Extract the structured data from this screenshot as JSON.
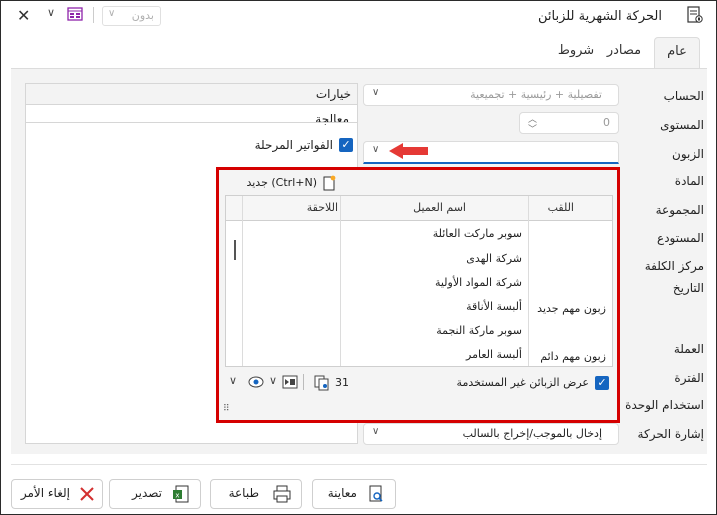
{
  "window": {
    "title": "الحركة الشهرية للزبائن",
    "view_select": "بدون"
  },
  "tabs": [
    {
      "label": "عام"
    },
    {
      "label": "مصادر"
    },
    {
      "label": "شروط"
    }
  ],
  "fields": {
    "account": {
      "label": "الحساب",
      "value": "تفصيلية + رئيسية + تجميعية"
    },
    "level": {
      "label": "المستوى",
      "value": "0"
    },
    "customer": {
      "label": "الزبون"
    },
    "material": {
      "label": "المادة"
    },
    "group": {
      "label": "المجموعة"
    },
    "warehouse": {
      "label": "المستودع"
    },
    "cost_center": {
      "label": "مركز الكلفة"
    },
    "date": {
      "label": "التاريخ"
    },
    "currency": {
      "label": "العملة"
    },
    "period": {
      "label": "الفترة"
    },
    "unit_usage": {
      "label": "استخدام الوحدة"
    },
    "movement_sign": {
      "label": "إشارة الحركة",
      "value": "إدخال بالموجب/إخراج بالسالب"
    }
  },
  "options_panel": {
    "header": "خيارات",
    "section": "معالجة",
    "posted_invoices": "الفواتير المرحلة"
  },
  "popup": {
    "new_label": "جديد (Ctrl+N)",
    "columns": {
      "title": "اللقب",
      "name": "اسم العميل",
      "suffix": "اللاحقة"
    },
    "rows": [
      {
        "title": "",
        "name": "سوبر ماركت العائلة"
      },
      {
        "title": "",
        "name": "شركة الهدى"
      },
      {
        "title": "",
        "name": "شركة المواد الأولية"
      },
      {
        "title": "زبون مهم جديد",
        "name": "ألبسة الأناقة"
      },
      {
        "title": "",
        "name": "سوبر ماركة النجمة"
      },
      {
        "title": "زبون مهم دائم",
        "name": "ألبسة العامر"
      }
    ],
    "show_unused": "عرض الزبائن غير المستخدمة",
    "count": "31"
  },
  "footer": {
    "preview": "معاينة",
    "print": "طباعة",
    "export": "تصدير",
    "cancel": "إلغاء الأمر"
  },
  "colors": {
    "accent": "#1565c0",
    "highlight": "#d50000",
    "arrow": "#e53935"
  }
}
